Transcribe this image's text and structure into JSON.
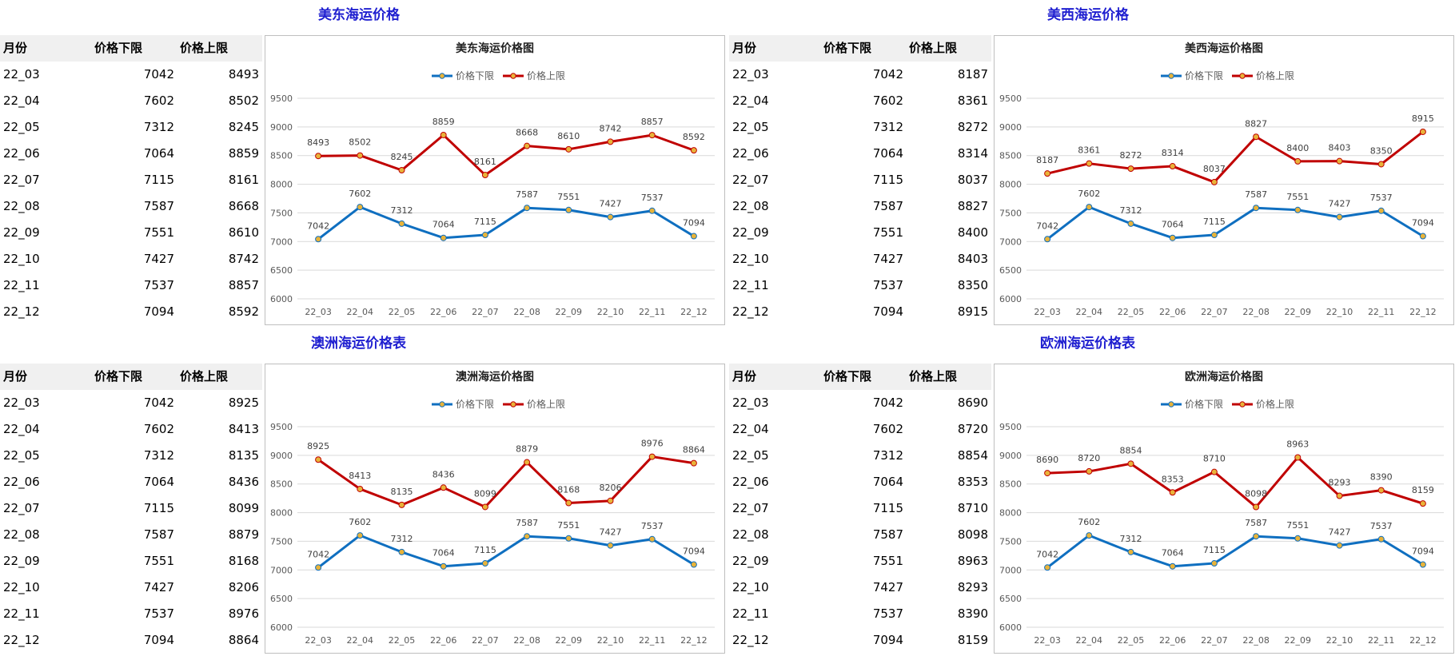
{
  "columns": {
    "month": "月份",
    "low": "价格下限",
    "high": "价格上限"
  },
  "panels": [
    {
      "title": "美东海运价格",
      "rows": [
        [
          "22_03",
          "7042",
          "8493"
        ],
        [
          "22_04",
          "7602",
          "8502"
        ],
        [
          "22_05",
          "7312",
          "8245"
        ],
        [
          "22_06",
          "7064",
          "8859"
        ],
        [
          "22_07",
          "7115",
          "8161"
        ],
        [
          "22_08",
          "7587",
          "8668"
        ],
        [
          "22_09",
          "7551",
          "8610"
        ],
        [
          "22_10",
          "7427",
          "8742"
        ],
        [
          "22_11",
          "7537",
          "8857"
        ],
        [
          "22_12",
          "7094",
          "8592"
        ]
      ]
    },
    {
      "title": "美西海运价格",
      "rows": [
        [
          "22_03",
          "7042",
          "8187"
        ],
        [
          "22_04",
          "7602",
          "8361"
        ],
        [
          "22_05",
          "7312",
          "8272"
        ],
        [
          "22_06",
          "7064",
          "8314"
        ],
        [
          "22_07",
          "7115",
          "8037"
        ],
        [
          "22_08",
          "7587",
          "8827"
        ],
        [
          "22_09",
          "7551",
          "8400"
        ],
        [
          "22_10",
          "7427",
          "8403"
        ],
        [
          "22_11",
          "7537",
          "8350"
        ],
        [
          "22_12",
          "7094",
          "8915"
        ]
      ]
    },
    {
      "title": "澳洲海运价格表",
      "rows": [
        [
          "22_03",
          "7042",
          "8925"
        ],
        [
          "22_04",
          "7602",
          "8413"
        ],
        [
          "22_05",
          "7312",
          "8135"
        ],
        [
          "22_06",
          "7064",
          "8436"
        ],
        [
          "22_07",
          "7115",
          "8099"
        ],
        [
          "22_08",
          "7587",
          "8879"
        ],
        [
          "22_09",
          "7551",
          "8168"
        ],
        [
          "22_10",
          "7427",
          "8206"
        ],
        [
          "22_11",
          "7537",
          "8976"
        ],
        [
          "22_12",
          "7094",
          "8864"
        ]
      ]
    },
    {
      "title": "欧洲海运价格表",
      "rows": [
        [
          "22_03",
          "7042",
          "8690"
        ],
        [
          "22_04",
          "7602",
          "8720"
        ],
        [
          "22_05",
          "7312",
          "8854"
        ],
        [
          "22_06",
          "7064",
          "8353"
        ],
        [
          "22_07",
          "7115",
          "8710"
        ],
        [
          "22_08",
          "7587",
          "8098"
        ],
        [
          "22_09",
          "7551",
          "8963"
        ],
        [
          "22_10",
          "7427",
          "8293"
        ],
        [
          "22_11",
          "7537",
          "8390"
        ],
        [
          "22_12",
          "7094",
          "8159"
        ]
      ]
    }
  ],
  "colors": {
    "low_line": "#0f6fc0",
    "high_line": "#c00000",
    "marker_fill": "#e8b33a",
    "title": "#1f1fd0",
    "grid": "#d9d9d9",
    "header_bg": "#f0f0f0"
  },
  "chart_data": [
    {
      "type": "line",
      "title": "美东海运价格图",
      "categories": [
        "22_03",
        "22_04",
        "22_05",
        "22_06",
        "22_07",
        "22_08",
        "22_09",
        "22_10",
        "22_11",
        "22_12"
      ],
      "series": [
        {
          "name": "价格下限",
          "values": [
            7042,
            7602,
            7312,
            7064,
            7115,
            7587,
            7551,
            7427,
            7537,
            7094
          ]
        },
        {
          "name": "价格上限",
          "values": [
            8493,
            8502,
            8245,
            8859,
            8161,
            8668,
            8610,
            8742,
            8857,
            8592
          ]
        }
      ],
      "ylim": [
        6000,
        9500
      ],
      "yticks": [
        6000,
        6500,
        7000,
        7500,
        8000,
        8500,
        9000,
        9500
      ],
      "grid": true,
      "legend": "top",
      "data_labels": true
    },
    {
      "type": "line",
      "title": "美西海运价格图",
      "categories": [
        "22_03",
        "22_04",
        "22_05",
        "22_06",
        "22_07",
        "22_08",
        "22_09",
        "22_10",
        "22_11",
        "22_12"
      ],
      "series": [
        {
          "name": "价格下限",
          "values": [
            7042,
            7602,
            7312,
            7064,
            7115,
            7587,
            7551,
            7427,
            7537,
            7094
          ]
        },
        {
          "name": "价格上限",
          "values": [
            8187,
            8361,
            8272,
            8314,
            8037,
            8827,
            8400,
            8403,
            8350,
            8915
          ]
        }
      ],
      "ylim": [
        6000,
        9500
      ],
      "yticks": [
        6000,
        6500,
        7000,
        7500,
        8000,
        8500,
        9000,
        9500
      ],
      "grid": true,
      "legend": "top",
      "data_labels": true
    },
    {
      "type": "line",
      "title": "澳洲海运价格图",
      "categories": [
        "22_03",
        "22_04",
        "22_05",
        "22_06",
        "22_07",
        "22_08",
        "22_09",
        "22_10",
        "22_11",
        "22_12"
      ],
      "series": [
        {
          "name": "价格下限",
          "values": [
            7042,
            7602,
            7312,
            7064,
            7115,
            7587,
            7551,
            7427,
            7537,
            7094
          ]
        },
        {
          "name": "价格上限",
          "values": [
            8925,
            8413,
            8135,
            8436,
            8099,
            8879,
            8168,
            8206,
            8976,
            8864
          ]
        }
      ],
      "ylim": [
        6000,
        9500
      ],
      "yticks": [
        6000,
        6500,
        7000,
        7500,
        8000,
        8500,
        9000,
        9500
      ],
      "grid": true,
      "legend": "top",
      "data_labels": true
    },
    {
      "type": "line",
      "title": "欧洲海运价格图",
      "categories": [
        "22_03",
        "22_04",
        "22_05",
        "22_06",
        "22_07",
        "22_08",
        "22_09",
        "22_10",
        "22_11",
        "22_12"
      ],
      "series": [
        {
          "name": "价格下限",
          "values": [
            7042,
            7602,
            7312,
            7064,
            7115,
            7587,
            7551,
            7427,
            7537,
            7094
          ]
        },
        {
          "name": "价格上限",
          "values": [
            8690,
            8720,
            8854,
            8353,
            8710,
            8098,
            8963,
            8293,
            8390,
            8159
          ]
        }
      ],
      "ylim": [
        6000,
        9500
      ],
      "yticks": [
        6000,
        6500,
        7000,
        7500,
        8000,
        8500,
        9000,
        9500
      ],
      "grid": true,
      "legend": "top",
      "data_labels": true
    }
  ]
}
